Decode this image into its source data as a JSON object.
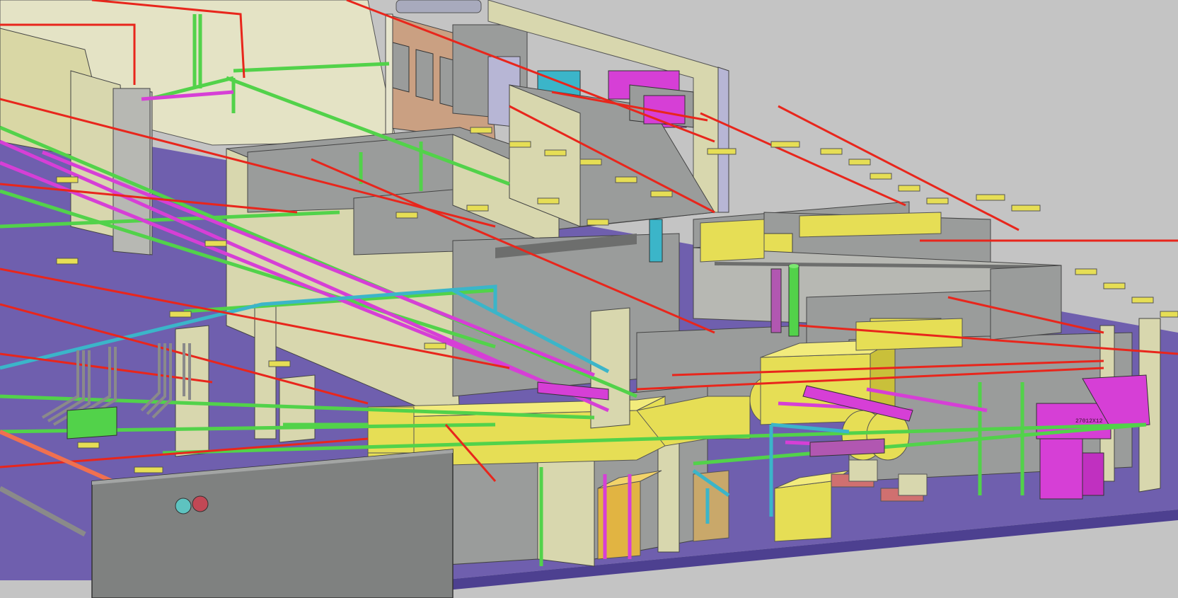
{
  "view": {
    "background": "#c4c4c4",
    "floor_color": "#6f5fae",
    "wall_color": "#9a9c9b",
    "wall_face_light": "#d8d7ae",
    "duct_color": "#e6de55",
    "pipe_colors": {
      "fire": "#e8261c",
      "green": "#52d24a",
      "magenta": "#d63fd6",
      "cyan": "#3bb5c9",
      "blue": "#3b8fd9"
    }
  },
  "labels": {
    "equipment_tag": "27012X12"
  },
  "layers": [
    {
      "name": "floor-slab-layer",
      "color": "#6f5fae"
    },
    {
      "name": "walls-layer",
      "color": "#9a9c9b"
    },
    {
      "name": "ductwork-layer",
      "color": "#e6de55"
    },
    {
      "name": "fire-sprinkler-layer",
      "color": "#e8261c"
    },
    {
      "name": "domestic-water-layer",
      "color": "#52d24a"
    },
    {
      "name": "gas-piping-layer",
      "color": "#d63fd6"
    },
    {
      "name": "chilled-water-layer",
      "color": "#3bb5c9"
    }
  ]
}
